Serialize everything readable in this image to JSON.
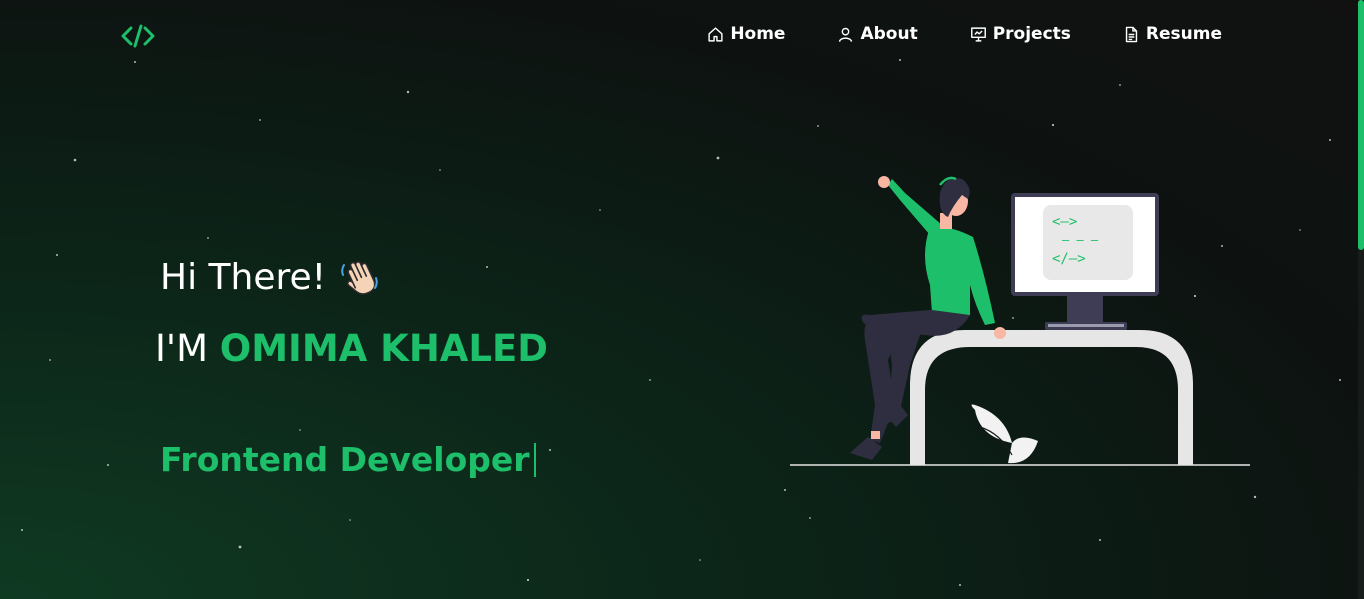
{
  "nav": {
    "logo_icon": "code-brackets-icon",
    "items": [
      {
        "label": "Home",
        "icon": "home-icon"
      },
      {
        "label": "About",
        "icon": "user-icon"
      },
      {
        "label": "Projects",
        "icon": "presentation-icon"
      },
      {
        "label": "Resume",
        "icon": "document-icon"
      }
    ]
  },
  "hero": {
    "greeting": "Hi There!",
    "greeting_icon": "waving-hand-icon",
    "intro_prefix": "I'M",
    "name": "OMIMA KHALED",
    "role": "Frontend Developer"
  },
  "illustration": {
    "screen_lines": [
      "<—>",
      "— — —",
      "</—>"
    ]
  },
  "colors": {
    "accent": "#1dbf6a",
    "background_dark": "#111111",
    "background_green": "#0f3a22",
    "text": "#ffffff"
  }
}
